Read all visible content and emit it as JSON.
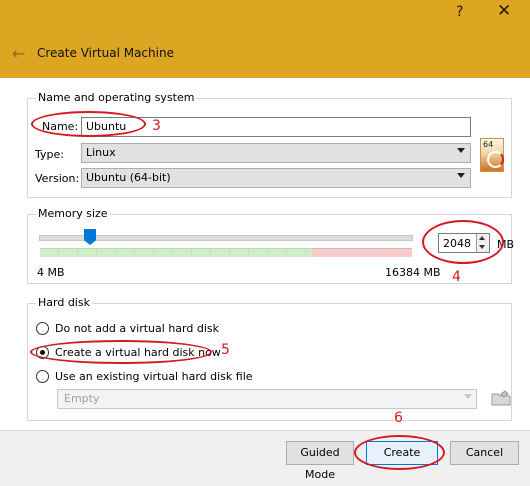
{
  "window": {
    "title": "Create Virtual Machine",
    "help_glyph": "?",
    "close_glyph": "✕",
    "back_glyph": "←",
    "title_bar_color": "#dca623",
    "accent_color": "#0078d7",
    "annotation_color": "#d71920"
  },
  "name_os": {
    "group_title": "Name and operating system",
    "name_label": "Name:",
    "name_value": "Ubuntu",
    "type_label": "Type:",
    "type_value": "Linux",
    "version_label": "Version:",
    "version_value": "Ubuntu (64-bit)",
    "os_icon_badge": "64",
    "os_icon": "ubuntu-64-icon"
  },
  "memory": {
    "group_title": "Memory size",
    "value": "2048",
    "unit": "MB",
    "min_label": "4 MB",
    "max_label": "16384 MB",
    "slider_fraction": 0.125
  },
  "hard_disk": {
    "group_title": "Hard disk",
    "options": [
      {
        "label": "Do not add a virtual hard disk",
        "checked": false
      },
      {
        "label": "Create a virtual hard disk now",
        "checked": true
      },
      {
        "label": "Use an existing virtual hard disk file",
        "checked": false
      }
    ],
    "existing_file_value": "Empty",
    "folder_icon": "folder-icon"
  },
  "buttons": {
    "guided_mode": "Guided Mode",
    "create": "Create",
    "cancel": "Cancel"
  },
  "annotations": [
    "3",
    "4",
    "5",
    "6"
  ]
}
